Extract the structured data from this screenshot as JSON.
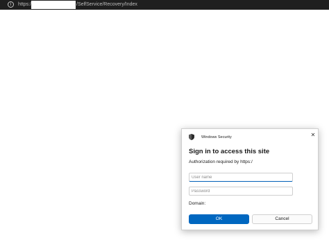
{
  "addressbar": {
    "info_icon": "i",
    "url_prefix": "https://",
    "url_suffix": "/SelfService/Recovery/Index"
  },
  "dialog": {
    "window_title": "Windows Security",
    "close_glyph": "✕",
    "heading": "Sign in to access this site",
    "authorization_text": "Authorization required by https:/",
    "username_placeholder": "User name",
    "username_value": "",
    "password_placeholder": "Password",
    "password_value": "",
    "domain_label": "Domain:",
    "ok_label": "OK",
    "cancel_label": "Cancel"
  },
  "colors": {
    "accent": "#0067c0",
    "addressbar_bg": "#1f1f1f"
  },
  "icons": [
    "info-icon",
    "shield-icon",
    "close-icon"
  ]
}
